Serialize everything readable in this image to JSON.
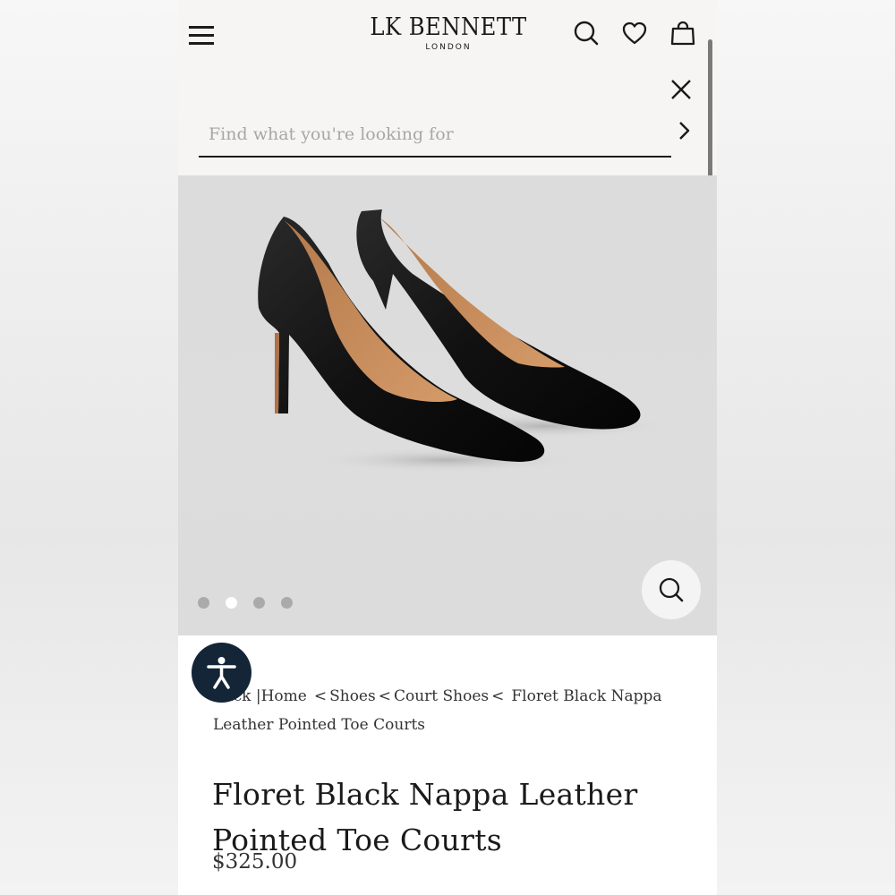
{
  "brand": {
    "name": "LK BENNETT",
    "sub": "LONDON"
  },
  "header": {
    "menu_icon": "hamburger-menu-icon",
    "search_icon": "search-icon",
    "wishlist_icon": "heart-icon",
    "bag_icon": "shopping-bag-icon"
  },
  "search": {
    "placeholder": "Find what you're looking for",
    "value": "",
    "close_icon": "close-icon",
    "submit_icon": "chevron-right-icon"
  },
  "gallery": {
    "image_alt": "Pair of black pointed toe court shoes",
    "slide_count": 4,
    "active_slide": 2,
    "zoom_icon": "zoom-search-icon"
  },
  "accessibility": {
    "icon": "accessibility-icon"
  },
  "breadcrumb": {
    "back": "Back",
    "home": "Home",
    "shoes": "Shoes",
    "court_shoes": "Court Shoes",
    "current": "Floret Black Nappa Leather Pointed Toe Courts"
  },
  "product": {
    "title": "Floret Black Nappa Leather Pointed Toe Courts",
    "price": "$325.00"
  },
  "colors": {
    "accent_dark": "#132536",
    "header_bg": "#f6f5f3",
    "text": "#1a1a1a"
  }
}
